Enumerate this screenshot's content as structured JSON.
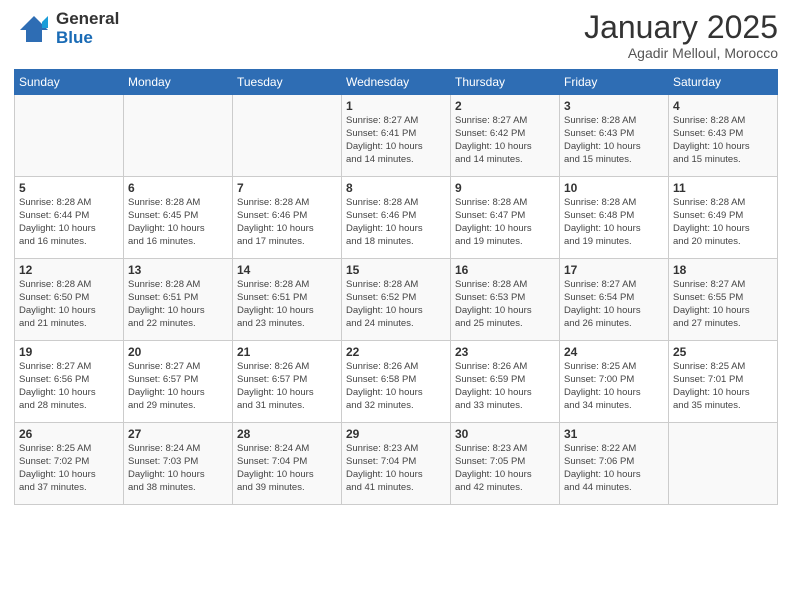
{
  "header": {
    "logo_general": "General",
    "logo_blue": "Blue",
    "month_title": "January 2025",
    "location": "Agadir Melloul, Morocco"
  },
  "calendar": {
    "days_header": [
      "Sunday",
      "Monday",
      "Tuesday",
      "Wednesday",
      "Thursday",
      "Friday",
      "Saturday"
    ],
    "weeks": [
      [
        {
          "day": "",
          "info": ""
        },
        {
          "day": "",
          "info": ""
        },
        {
          "day": "",
          "info": ""
        },
        {
          "day": "1",
          "info": "Sunrise: 8:27 AM\nSunset: 6:41 PM\nDaylight: 10 hours\nand 14 minutes."
        },
        {
          "day": "2",
          "info": "Sunrise: 8:27 AM\nSunset: 6:42 PM\nDaylight: 10 hours\nand 14 minutes."
        },
        {
          "day": "3",
          "info": "Sunrise: 8:28 AM\nSunset: 6:43 PM\nDaylight: 10 hours\nand 15 minutes."
        },
        {
          "day": "4",
          "info": "Sunrise: 8:28 AM\nSunset: 6:43 PM\nDaylight: 10 hours\nand 15 minutes."
        }
      ],
      [
        {
          "day": "5",
          "info": "Sunrise: 8:28 AM\nSunset: 6:44 PM\nDaylight: 10 hours\nand 16 minutes."
        },
        {
          "day": "6",
          "info": "Sunrise: 8:28 AM\nSunset: 6:45 PM\nDaylight: 10 hours\nand 16 minutes."
        },
        {
          "day": "7",
          "info": "Sunrise: 8:28 AM\nSunset: 6:46 PM\nDaylight: 10 hours\nand 17 minutes."
        },
        {
          "day": "8",
          "info": "Sunrise: 8:28 AM\nSunset: 6:46 PM\nDaylight: 10 hours\nand 18 minutes."
        },
        {
          "day": "9",
          "info": "Sunrise: 8:28 AM\nSunset: 6:47 PM\nDaylight: 10 hours\nand 19 minutes."
        },
        {
          "day": "10",
          "info": "Sunrise: 8:28 AM\nSunset: 6:48 PM\nDaylight: 10 hours\nand 19 minutes."
        },
        {
          "day": "11",
          "info": "Sunrise: 8:28 AM\nSunset: 6:49 PM\nDaylight: 10 hours\nand 20 minutes."
        }
      ],
      [
        {
          "day": "12",
          "info": "Sunrise: 8:28 AM\nSunset: 6:50 PM\nDaylight: 10 hours\nand 21 minutes."
        },
        {
          "day": "13",
          "info": "Sunrise: 8:28 AM\nSunset: 6:51 PM\nDaylight: 10 hours\nand 22 minutes."
        },
        {
          "day": "14",
          "info": "Sunrise: 8:28 AM\nSunset: 6:51 PM\nDaylight: 10 hours\nand 23 minutes."
        },
        {
          "day": "15",
          "info": "Sunrise: 8:28 AM\nSunset: 6:52 PM\nDaylight: 10 hours\nand 24 minutes."
        },
        {
          "day": "16",
          "info": "Sunrise: 8:28 AM\nSunset: 6:53 PM\nDaylight: 10 hours\nand 25 minutes."
        },
        {
          "day": "17",
          "info": "Sunrise: 8:27 AM\nSunset: 6:54 PM\nDaylight: 10 hours\nand 26 minutes."
        },
        {
          "day": "18",
          "info": "Sunrise: 8:27 AM\nSunset: 6:55 PM\nDaylight: 10 hours\nand 27 minutes."
        }
      ],
      [
        {
          "day": "19",
          "info": "Sunrise: 8:27 AM\nSunset: 6:56 PM\nDaylight: 10 hours\nand 28 minutes."
        },
        {
          "day": "20",
          "info": "Sunrise: 8:27 AM\nSunset: 6:57 PM\nDaylight: 10 hours\nand 29 minutes."
        },
        {
          "day": "21",
          "info": "Sunrise: 8:26 AM\nSunset: 6:57 PM\nDaylight: 10 hours\nand 31 minutes."
        },
        {
          "day": "22",
          "info": "Sunrise: 8:26 AM\nSunset: 6:58 PM\nDaylight: 10 hours\nand 32 minutes."
        },
        {
          "day": "23",
          "info": "Sunrise: 8:26 AM\nSunset: 6:59 PM\nDaylight: 10 hours\nand 33 minutes."
        },
        {
          "day": "24",
          "info": "Sunrise: 8:25 AM\nSunset: 7:00 PM\nDaylight: 10 hours\nand 34 minutes."
        },
        {
          "day": "25",
          "info": "Sunrise: 8:25 AM\nSunset: 7:01 PM\nDaylight: 10 hours\nand 35 minutes."
        }
      ],
      [
        {
          "day": "26",
          "info": "Sunrise: 8:25 AM\nSunset: 7:02 PM\nDaylight: 10 hours\nand 37 minutes."
        },
        {
          "day": "27",
          "info": "Sunrise: 8:24 AM\nSunset: 7:03 PM\nDaylight: 10 hours\nand 38 minutes."
        },
        {
          "day": "28",
          "info": "Sunrise: 8:24 AM\nSunset: 7:04 PM\nDaylight: 10 hours\nand 39 minutes."
        },
        {
          "day": "29",
          "info": "Sunrise: 8:23 AM\nSunset: 7:04 PM\nDaylight: 10 hours\nand 41 minutes."
        },
        {
          "day": "30",
          "info": "Sunrise: 8:23 AM\nSunset: 7:05 PM\nDaylight: 10 hours\nand 42 minutes."
        },
        {
          "day": "31",
          "info": "Sunrise: 8:22 AM\nSunset: 7:06 PM\nDaylight: 10 hours\nand 44 minutes."
        },
        {
          "day": "",
          "info": ""
        }
      ]
    ]
  }
}
